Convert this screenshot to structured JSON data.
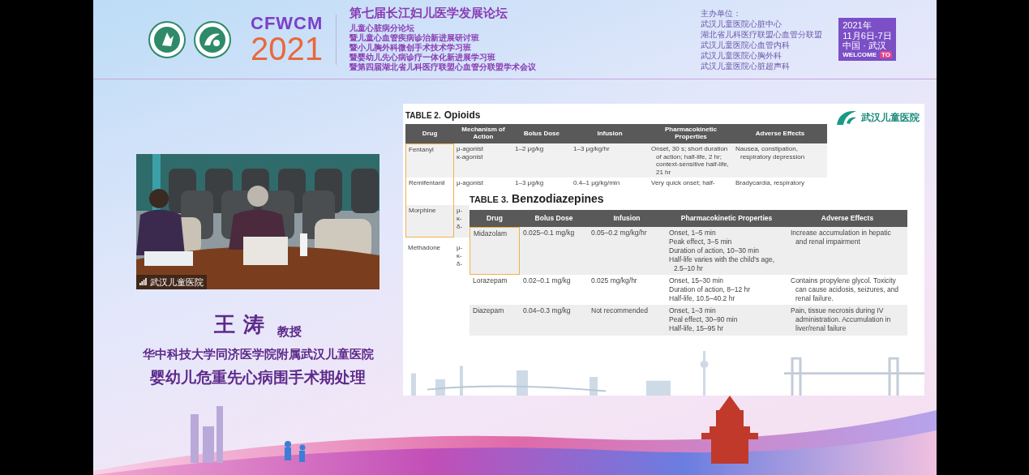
{
  "header": {
    "brand": "CFWCM",
    "year": "2021",
    "title": "第七届长江妇儿医学发展论坛",
    "subtitles": [
      "儿童心脏病分论坛",
      "暨儿童心血管疾病诊治新进展研讨班",
      "暨小儿胸外科微创手术技术学习班",
      "暨婴幼儿先心病诊疗一体化新进展学习班",
      "暨第四届湖北省儿科医疗联盟心血管分联盟学术会议"
    ],
    "organizers_label": "主办单位：",
    "organizers": [
      "武汉儿童医院心脏中心",
      "湖北省儿科医疗联盟心血管分联盟",
      "武汉儿童医院心血管内科",
      "武汉儿童医院心胸外科",
      "武汉儿童医院心脏超声科"
    ],
    "date_badge": {
      "year": "2021年",
      "dates": "11月6日-7日",
      "place": "中国 · 武汉",
      "welcome": "WELCOME",
      "to": "TO"
    }
  },
  "video": {
    "caption": "武汉儿童医院"
  },
  "speaker": {
    "name": "王 涛",
    "title": "教授",
    "affiliation": "华中科技大学同济医学院附属武汉儿童医院",
    "topic": "婴幼儿危重先心病围手术期处理"
  },
  "slide": {
    "logo_text": "武汉儿童医院",
    "table_2": {
      "label": "TABLE 2.",
      "name": "Opioids",
      "columns": [
        "Drug",
        "Mechanism of Action",
        "Bolus Dose",
        "Infusion",
        "Pharmacokinetic Properties",
        "Adverse Effects"
      ],
      "rows": [
        {
          "highlighted": true,
          "cells": [
            [
              "Fentanyl"
            ],
            [
              "μ-agonist",
              "κ-agonist"
            ],
            [
              "1–2 μg/kg"
            ],
            [
              "1–3 μg/kg/hr"
            ],
            [
              "Onset, 30 s; short duration of action; half-life, 2 hr; context-sensitive half-life, 21 hr"
            ],
            [
              "Nausea, constipation, respiratory depression"
            ]
          ]
        },
        {
          "highlighted": true,
          "cells": [
            [
              "Remifentanil"
            ],
            [
              "μ-agonist"
            ],
            [
              "1–3 μg/kg"
            ],
            [
              "0.4–1 μg/kg/min"
            ],
            [
              "Very quick onset; half-"
            ],
            [
              "Bradycardia, respiratory"
            ]
          ]
        },
        {
          "highlighted": true,
          "cells": [
            [
              "Morphine"
            ],
            [
              "μ-",
              "κ-",
              "δ-"
            ]
          ]
        },
        {
          "highlighted": false,
          "cells": [
            [
              "Methadone"
            ],
            [
              "μ-",
              "κ-",
              "δ-"
            ]
          ]
        }
      ]
    },
    "table_3": {
      "label": "TABLE 3.",
      "name": "Benzodiazepines",
      "columns": [
        "Drug",
        "Bolus Dose",
        "Infusion",
        "Pharmacokinetic Properties",
        "Adverse Effects"
      ],
      "rows": [
        {
          "highlighted": true,
          "cells": [
            [
              "Midazolam"
            ],
            [
              "0.025–0.1 mg/kg"
            ],
            [
              "0.05–0.2 mg/kg/hr"
            ],
            [
              "Onset, 1–5 min",
              "Peak effect, 3–5 min",
              "Duration of action, 10–30 min",
              "Half-life varies with the child's age, 2.5–10 hr"
            ],
            [
              "Increase accumulation in hepatic and renal impairment"
            ]
          ]
        },
        {
          "highlighted": false,
          "cells": [
            [
              "Lorazepam"
            ],
            [
              "0.02–0.1 mg/kg"
            ],
            [
              "0.025 mg/kg/hr"
            ],
            [
              "Onset, 15–30 min",
              "Duration of action, 8–12 hr",
              "Half-life, 10.5–40.2 hr"
            ],
            [
              "Contains propylene glycol. Toxicity can cause acidosis, seizures, and renal failure."
            ]
          ]
        },
        {
          "highlighted": false,
          "cells": [
            [
              "Diazepam"
            ],
            [
              "0.04–0.3 mg/kg"
            ],
            [
              "Not recommended"
            ],
            [
              "Onset, 1–3 min",
              "Peal effect, 30–90 min",
              "Half-life, 15–95 hr"
            ],
            [
              "Pain, tissue necrosis during IV administration. Accumulation in liver/renal failure"
            ]
          ]
        }
      ]
    }
  }
}
